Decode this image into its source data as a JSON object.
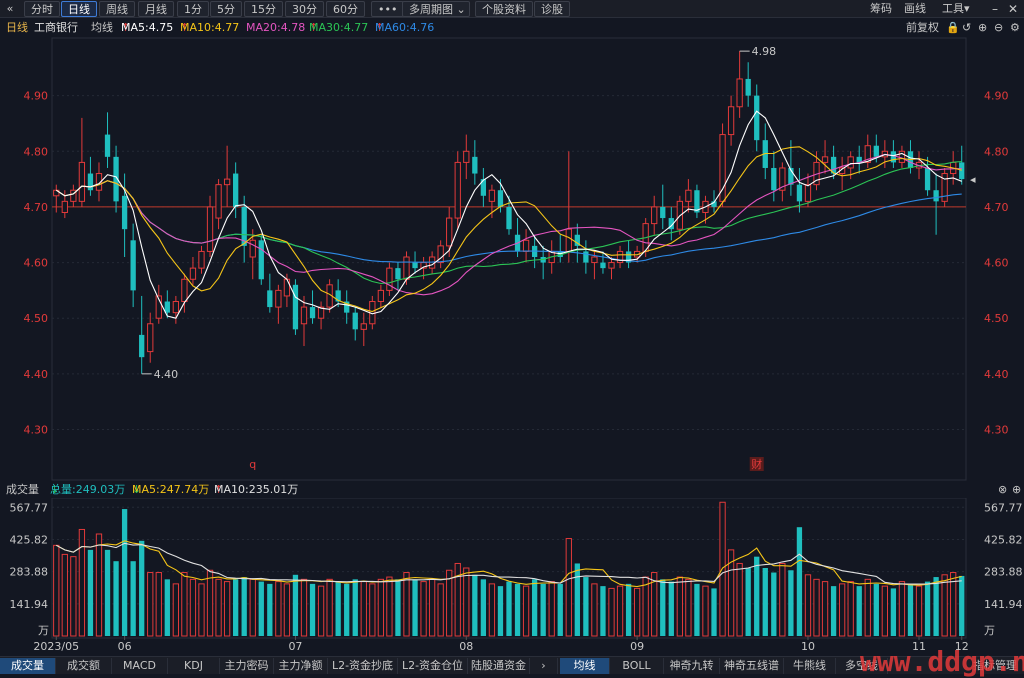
{
  "toolbar": {
    "back_icon": "«",
    "tabs": [
      "分时",
      "日线",
      "周线",
      "月线",
      "1分",
      "5分",
      "15分",
      "30分",
      "60分",
      "•••",
      "多周期图",
      "个股资料",
      "诊股"
    ],
    "active_tab": "日线",
    "dropdown_icon": "chevron-down-icon",
    "right": [
      "筹码",
      "画线",
      "工具"
    ]
  },
  "info": {
    "period": "日线",
    "name": "工商银行",
    "ma_label": "均线",
    "ma5": "MA5:4.75",
    "ma10": "MA10:4.77",
    "ma20": "MA20:4.78",
    "ma30": "MA30:4.77",
    "ma60": "MA60:4.76",
    "fq": "前复权",
    "colors": {
      "ma5": "#ffffff",
      "ma10": "#f5c518",
      "ma20": "#e455c0",
      "ma30": "#2bc455",
      "ma60": "#2e8ae6",
      "up": "#e23a3a",
      "down": "#1fbfbf"
    }
  },
  "price_axis": {
    "labels": [
      "4.90",
      "4.80",
      "4.70",
      "4.60",
      "4.50",
      "4.40",
      "4.30"
    ],
    "left_labels": [
      "4.90",
      "4.80",
      "4.70",
      "4.60",
      "4.50",
      "4.40",
      "4.30"
    ],
    "ref_line": "4.70"
  },
  "annotations": {
    "high": "4.98",
    "low": "4.40",
    "marker_q": "q",
    "marker_cai": "财"
  },
  "volume": {
    "title": "成交量",
    "total": "总量:249.03万",
    "ma5": "MA5:247.74万",
    "ma10": "MA10:235.01万",
    "axis": [
      "567.77",
      "425.82",
      "283.88",
      "141.94"
    ],
    "unit": "万"
  },
  "dates": [
    "2023/05",
    "06",
    "07",
    "08",
    "09",
    "10",
    "11",
    "12"
  ],
  "bottom_tabs": [
    "成交量",
    "成交额",
    "MACD",
    "KDJ",
    "主力密码",
    "主力净额",
    "L2-资金抄底",
    "L2-资金仓位",
    "陆股通资金"
  ],
  "bottom_tabs_right": [
    "均线",
    "BOLL",
    "神奇九转",
    "神奇五线谱",
    "牛熊线",
    "多空线",
    "指标管理"
  ],
  "watermark": "www.ddgp.net",
  "chart_data": {
    "type": "candlestick",
    "ylim": [
      4.22,
      5.0
    ],
    "volume_ylim": [
      0,
      600
    ],
    "candles": [
      [
        4.72,
        4.74,
        4.69,
        4.73,
        400
      ],
      [
        4.69,
        4.73,
        4.68,
        4.71,
        360
      ],
      [
        4.71,
        4.74,
        4.7,
        4.73,
        350
      ],
      [
        4.71,
        4.86,
        4.7,
        4.78,
        470
      ],
      [
        4.76,
        4.79,
        4.72,
        4.73,
        380
      ],
      [
        4.73,
        4.78,
        4.71,
        4.76,
        450
      ],
      [
        4.83,
        4.87,
        4.77,
        4.79,
        380
      ],
      [
        4.79,
        4.81,
        4.69,
        4.71,
        330
      ],
      [
        4.72,
        4.76,
        4.61,
        4.66,
        560
      ],
      [
        4.64,
        4.67,
        4.52,
        4.55,
        330
      ],
      [
        4.47,
        4.54,
        4.4,
        4.43,
        420
      ],
      [
        4.44,
        4.51,
        4.42,
        4.49,
        280
      ],
      [
        4.5,
        4.56,
        4.49,
        4.54,
        280
      ],
      [
        4.53,
        4.55,
        4.5,
        4.51,
        250
      ],
      [
        4.51,
        4.54,
        4.49,
        4.53,
        230
      ],
      [
        4.53,
        4.58,
        4.51,
        4.57,
        280
      ],
      [
        4.57,
        4.61,
        4.56,
        4.59,
        250
      ],
      [
        4.59,
        4.63,
        4.58,
        4.62,
        230
      ],
      [
        4.62,
        4.72,
        4.61,
        4.7,
        290
      ],
      [
        4.68,
        4.75,
        4.66,
        4.74,
        250
      ],
      [
        4.74,
        4.81,
        4.7,
        4.75,
        240
      ],
      [
        4.76,
        4.78,
        4.68,
        4.7,
        250
      ],
      [
        4.7,
        4.72,
        4.6,
        4.63,
        260
      ],
      [
        4.61,
        4.66,
        4.57,
        4.64,
        250
      ],
      [
        4.64,
        4.65,
        4.56,
        4.57,
        240
      ],
      [
        4.55,
        4.58,
        4.51,
        4.52,
        230
      ],
      [
        4.52,
        4.56,
        4.49,
        4.55,
        240
      ],
      [
        4.54,
        4.58,
        4.52,
        4.57,
        230
      ],
      [
        4.56,
        4.57,
        4.47,
        4.48,
        270
      ],
      [
        4.49,
        4.54,
        4.45,
        4.52,
        250
      ],
      [
        4.52,
        4.55,
        4.49,
        4.5,
        230
      ],
      [
        4.5,
        4.53,
        4.48,
        4.52,
        220
      ],
      [
        4.52,
        4.57,
        4.51,
        4.56,
        250
      ],
      [
        4.55,
        4.57,
        4.52,
        4.53,
        240
      ],
      [
        4.53,
        4.55,
        4.49,
        4.51,
        230
      ],
      [
        4.51,
        4.52,
        4.46,
        4.48,
        250
      ],
      [
        4.48,
        4.51,
        4.45,
        4.49,
        240
      ],
      [
        4.49,
        4.54,
        4.48,
        4.53,
        230
      ],
      [
        4.53,
        4.56,
        4.52,
        4.55,
        250
      ],
      [
        4.55,
        4.6,
        4.54,
        4.59,
        260
      ],
      [
        4.59,
        4.6,
        4.55,
        4.57,
        250
      ],
      [
        4.57,
        4.62,
        4.56,
        4.61,
        280
      ],
      [
        4.6,
        4.62,
        4.58,
        4.59,
        250
      ],
      [
        4.59,
        4.61,
        4.57,
        4.6,
        240
      ],
      [
        4.59,
        4.62,
        4.58,
        4.61,
        250
      ],
      [
        4.6,
        4.64,
        4.59,
        4.63,
        230
      ],
      [
        4.63,
        4.7,
        4.61,
        4.68,
        290
      ],
      [
        4.68,
        4.8,
        4.66,
        4.78,
        320
      ],
      [
        4.78,
        4.83,
        4.75,
        4.8,
        300
      ],
      [
        4.79,
        4.82,
        4.74,
        4.76,
        270
      ],
      [
        4.75,
        4.77,
        4.7,
        4.72,
        250
      ],
      [
        4.71,
        4.74,
        4.68,
        4.73,
        230
      ],
      [
        4.73,
        4.75,
        4.69,
        4.7,
        220
      ],
      [
        4.7,
        4.72,
        4.65,
        4.66,
        240
      ],
      [
        4.65,
        4.68,
        4.61,
        4.62,
        230
      ],
      [
        4.62,
        4.66,
        4.6,
        4.64,
        220
      ],
      [
        4.63,
        4.65,
        4.59,
        4.61,
        250
      ],
      [
        4.61,
        4.63,
        4.57,
        4.6,
        230
      ],
      [
        4.6,
        4.64,
        4.58,
        4.62,
        240
      ],
      [
        4.62,
        4.65,
        4.6,
        4.61,
        230
      ],
      [
        4.62,
        4.8,
        4.6,
        4.66,
        430
      ],
      [
        4.65,
        4.67,
        4.6,
        4.63,
        320
      ],
      [
        4.62,
        4.64,
        4.58,
        4.6,
        260
      ],
      [
        4.6,
        4.62,
        4.57,
        4.61,
        230
      ],
      [
        4.6,
        4.62,
        4.58,
        4.59,
        220
      ],
      [
        4.59,
        4.61,
        4.57,
        4.6,
        210
      ],
      [
        4.6,
        4.63,
        4.59,
        4.62,
        220
      ],
      [
        4.62,
        4.64,
        4.59,
        4.6,
        230
      ],
      [
        4.61,
        4.63,
        4.6,
        4.62,
        210
      ],
      [
        4.62,
        4.68,
        4.61,
        4.67,
        260
      ],
      [
        4.67,
        4.72,
        4.65,
        4.7,
        280
      ],
      [
        4.7,
        4.74,
        4.66,
        4.68,
        250
      ],
      [
        4.68,
        4.7,
        4.64,
        4.66,
        240
      ],
      [
        4.66,
        4.72,
        4.65,
        4.71,
        260
      ],
      [
        4.71,
        4.75,
        4.69,
        4.73,
        250
      ],
      [
        4.73,
        4.74,
        4.68,
        4.69,
        230
      ],
      [
        4.69,
        4.72,
        4.67,
        4.71,
        220
      ],
      [
        4.71,
        4.73,
        4.69,
        4.7,
        210
      ],
      [
        4.71,
        4.85,
        4.7,
        4.83,
        590
      ],
      [
        4.83,
        4.9,
        4.81,
        4.88,
        380
      ],
      [
        4.88,
        4.98,
        4.86,
        4.93,
        320
      ],
      [
        4.93,
        4.96,
        4.88,
        4.9,
        300
      ],
      [
        4.9,
        4.92,
        4.8,
        4.82,
        350
      ],
      [
        4.82,
        4.85,
        4.75,
        4.77,
        300
      ],
      [
        4.77,
        4.8,
        4.71,
        4.73,
        280
      ],
      [
        4.73,
        4.78,
        4.71,
        4.77,
        320
      ],
      [
        4.77,
        4.82,
        4.72,
        4.74,
        290
      ],
      [
        4.74,
        4.77,
        4.69,
        4.71,
        480
      ],
      [
        4.71,
        4.76,
        4.7,
        4.74,
        270
      ],
      [
        4.74,
        4.8,
        4.73,
        4.78,
        250
      ],
      [
        4.78,
        4.82,
        4.76,
        4.79,
        240
      ],
      [
        4.79,
        4.81,
        4.75,
        4.76,
        220
      ],
      [
        4.76,
        4.79,
        4.73,
        4.77,
        230
      ],
      [
        4.77,
        4.8,
        4.75,
        4.79,
        240
      ],
      [
        4.79,
        4.81,
        4.76,
        4.78,
        220
      ],
      [
        4.78,
        4.83,
        4.77,
        4.81,
        250
      ],
      [
        4.81,
        4.83,
        4.78,
        4.79,
        230
      ],
      [
        4.79,
        4.82,
        4.77,
        4.8,
        220
      ],
      [
        4.8,
        4.82,
        4.77,
        4.78,
        210
      ],
      [
        4.78,
        4.81,
        4.77,
        4.8,
        240
      ],
      [
        4.8,
        4.82,
        4.76,
        4.77,
        230
      ],
      [
        4.77,
        4.8,
        4.75,
        4.78,
        220
      ],
      [
        4.77,
        4.79,
        4.72,
        4.73,
        240
      ],
      [
        4.73,
        4.76,
        4.65,
        4.71,
        260
      ],
      [
        4.71,
        4.77,
        4.7,
        4.76,
        270
      ],
      [
        4.76,
        4.8,
        4.74,
        4.78,
        280
      ],
      [
        4.78,
        4.81,
        4.74,
        4.75,
        265
      ]
    ]
  }
}
